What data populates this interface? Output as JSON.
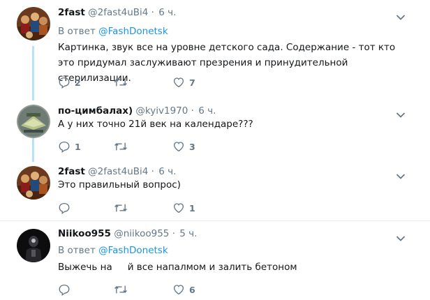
{
  "tweets": [
    {
      "name": "2fast",
      "handle": "@2fast4uBi4",
      "dot": "·",
      "time": "6 ч.",
      "reply_prefix": "В ответ",
      "reply_mention": "@FashDonetsk",
      "text": "Картинка, звук все на уровне детского сада. Содержание - тот кто это придумал заслуживают презрения и принудительной стерилизации.",
      "replies": "2",
      "retweets": "",
      "likes": "7"
    },
    {
      "name": "по-цимбалах)",
      "handle": "@kyiv1970",
      "dot": "·",
      "time": "6 ч.",
      "text": "А у них точно 21й век на календаре???",
      "replies": "1",
      "retweets": "",
      "likes": "3"
    },
    {
      "name": "2fast",
      "handle": "@2fast4uBi4",
      "dot": "·",
      "time": "6 ч.",
      "text": "Это правильный вопрос)",
      "replies": "",
      "retweets": "",
      "likes": "1"
    },
    {
      "name": "Niikoo955",
      "handle": "@niikoo955",
      "dot": "·",
      "time": "5 ч.",
      "reply_prefix": "В ответ",
      "reply_mention": "@FashDonetsk",
      "text_a": "Выжечь на",
      "text_b": "й все напалмом и залить бетоном",
      "replies": "",
      "retweets": "",
      "likes": "6"
    }
  ],
  "colors": {
    "accent": "#1b95e0",
    "muted": "#657786",
    "thread": "#b7e2f8",
    "divider": "#e6ecf0"
  },
  "icons": [
    "chevron-down-icon",
    "reply-icon",
    "retweet-icon",
    "like-icon"
  ]
}
